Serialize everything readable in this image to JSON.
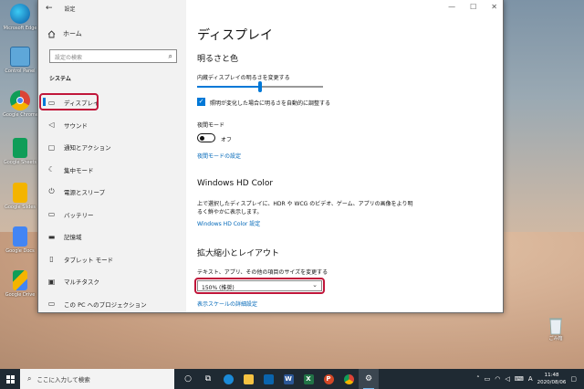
{
  "window": {
    "title": "設定",
    "minimize": "—",
    "maximize": "☐",
    "close": "✕"
  },
  "sidebar": {
    "home_label": "ホーム",
    "search_placeholder": "設定の検索",
    "section_title": "システム",
    "items": [
      {
        "label": "ディスプレイ",
        "icon": "monitor-icon",
        "active": true
      },
      {
        "label": "サウンド",
        "icon": "speaker-icon"
      },
      {
        "label": "通知とアクション",
        "icon": "notification-icon"
      },
      {
        "label": "集中モード",
        "icon": "moon-icon"
      },
      {
        "label": "電源とスリープ",
        "icon": "power-icon"
      },
      {
        "label": "バッテリー",
        "icon": "battery-icon"
      },
      {
        "label": "記憶域",
        "icon": "storage-icon"
      },
      {
        "label": "タブレット モード",
        "icon": "tablet-icon"
      },
      {
        "label": "マルチタスク",
        "icon": "multitask-icon"
      },
      {
        "label": "この PC へのプロジェクション",
        "icon": "projection-icon"
      }
    ]
  },
  "content": {
    "page_title": "ディスプレイ",
    "brightness_section": "明るさと色",
    "brightness_label": "内蔵ディスプレイの明るさを変更する",
    "brightness_value": 50,
    "auto_brightness_label": "照明が変化した場合に明るさを自動的に調整する",
    "auto_brightness_checked": true,
    "night_mode_label": "夜間モード",
    "night_mode_state": "オフ",
    "night_mode_settings_link": "夜間モードの設定",
    "hdr_section": "Windows HD Color",
    "hdr_description": "上で選択したディスプレイに、HDR や WCG のビデオ、ゲーム、アプリの画像をより明るく鮮やかに表示します。",
    "hdr_link": "Windows HD Color 設定",
    "scale_section": "拡大縮小とレイアウト",
    "scale_label": "テキスト、アプリ、その他の項目のサイズを変更する",
    "scale_value": "150% (推奨)",
    "scale_link": "表示スケールの詳細設定"
  },
  "desktop": {
    "icons": [
      {
        "label": "Microsoft Edge",
        "icon": "edge-icon"
      },
      {
        "label": "Control Panel",
        "icon": "control-panel-icon"
      },
      {
        "label": "Google Chrome",
        "icon": "chrome-icon"
      },
      {
        "label": "Google Sheets",
        "icon": "sheets-icon"
      },
      {
        "label": "Google Slides",
        "icon": "slides-icon"
      },
      {
        "label": "Google Docs",
        "icon": "docs-icon"
      },
      {
        "label": "Google Drive",
        "icon": "drive-icon"
      }
    ],
    "recycle_bin_label": "ごみ箱"
  },
  "taskbar": {
    "search_placeholder": "ここに入力して検索",
    "ime_indicator": "A",
    "time": "11:48",
    "date": "2020/08/06"
  },
  "colors": {
    "accent": "#0078d7",
    "highlight": "#c0163a",
    "taskbar": "#1f2a33"
  }
}
